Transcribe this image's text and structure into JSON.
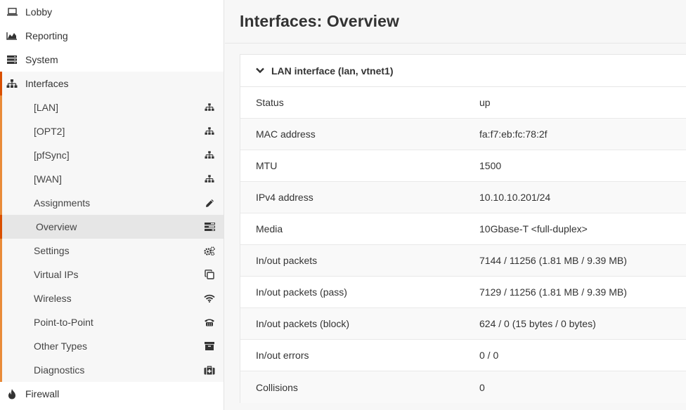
{
  "sidebar": {
    "top": [
      {
        "label": "Lobby",
        "icon": "laptop-icon"
      },
      {
        "label": "Reporting",
        "icon": "area-chart-icon"
      },
      {
        "label": "System",
        "icon": "server-icon"
      },
      {
        "label": "Interfaces",
        "icon": "sitemap-icon"
      }
    ],
    "interfaces_items": [
      {
        "label": "[LAN]",
        "icon": "sitemap-icon"
      },
      {
        "label": "[OPT2]",
        "icon": "sitemap-icon"
      },
      {
        "label": "[pfSync]",
        "icon": "sitemap-icon"
      },
      {
        "label": "[WAN]",
        "icon": "sitemap-icon"
      },
      {
        "label": "Assignments",
        "icon": "pencil-icon"
      },
      {
        "label": "Overview",
        "icon": "tasks-icon"
      },
      {
        "label": "Settings",
        "icon": "gears-icon"
      },
      {
        "label": "Virtual IPs",
        "icon": "clone-icon"
      },
      {
        "label": "Wireless",
        "icon": "wifi-icon"
      },
      {
        "label": "Point-to-Point",
        "icon": "phone-icon"
      },
      {
        "label": "Other Types",
        "icon": "archive-icon"
      },
      {
        "label": "Diagnostics",
        "icon": "medkit-icon"
      }
    ],
    "bottom": [
      {
        "label": "Firewall",
        "icon": "fire-icon"
      }
    ]
  },
  "main": {
    "title": "Interfaces: Overview",
    "panel": {
      "heading": "LAN interface (lan, vtnet1)",
      "rows": [
        {
          "key": "Status",
          "value": "up"
        },
        {
          "key": "MAC address",
          "value": "fa:f7:eb:fc:78:2f"
        },
        {
          "key": "MTU",
          "value": "1500"
        },
        {
          "key": "IPv4 address",
          "value": "10.10.10.201/24"
        },
        {
          "key": "Media",
          "value": "10Gbase-T <full-duplex>"
        },
        {
          "key": "In/out packets",
          "value": "7144 / 11256 (1.81 MB / 9.39 MB)"
        },
        {
          "key": "In/out packets (pass)",
          "value": "7129 / 11256 (1.81 MB / 9.39 MB)"
        },
        {
          "key": "In/out packets (block)",
          "value": "624 / 0 (15 bytes / 0 bytes)"
        },
        {
          "key": "In/out errors",
          "value": "0 / 0"
        },
        {
          "key": "Collisions",
          "value": "0"
        }
      ]
    }
  },
  "colors": {
    "accent_active": "#d94f00",
    "accent_submenu": "#e98b39"
  }
}
